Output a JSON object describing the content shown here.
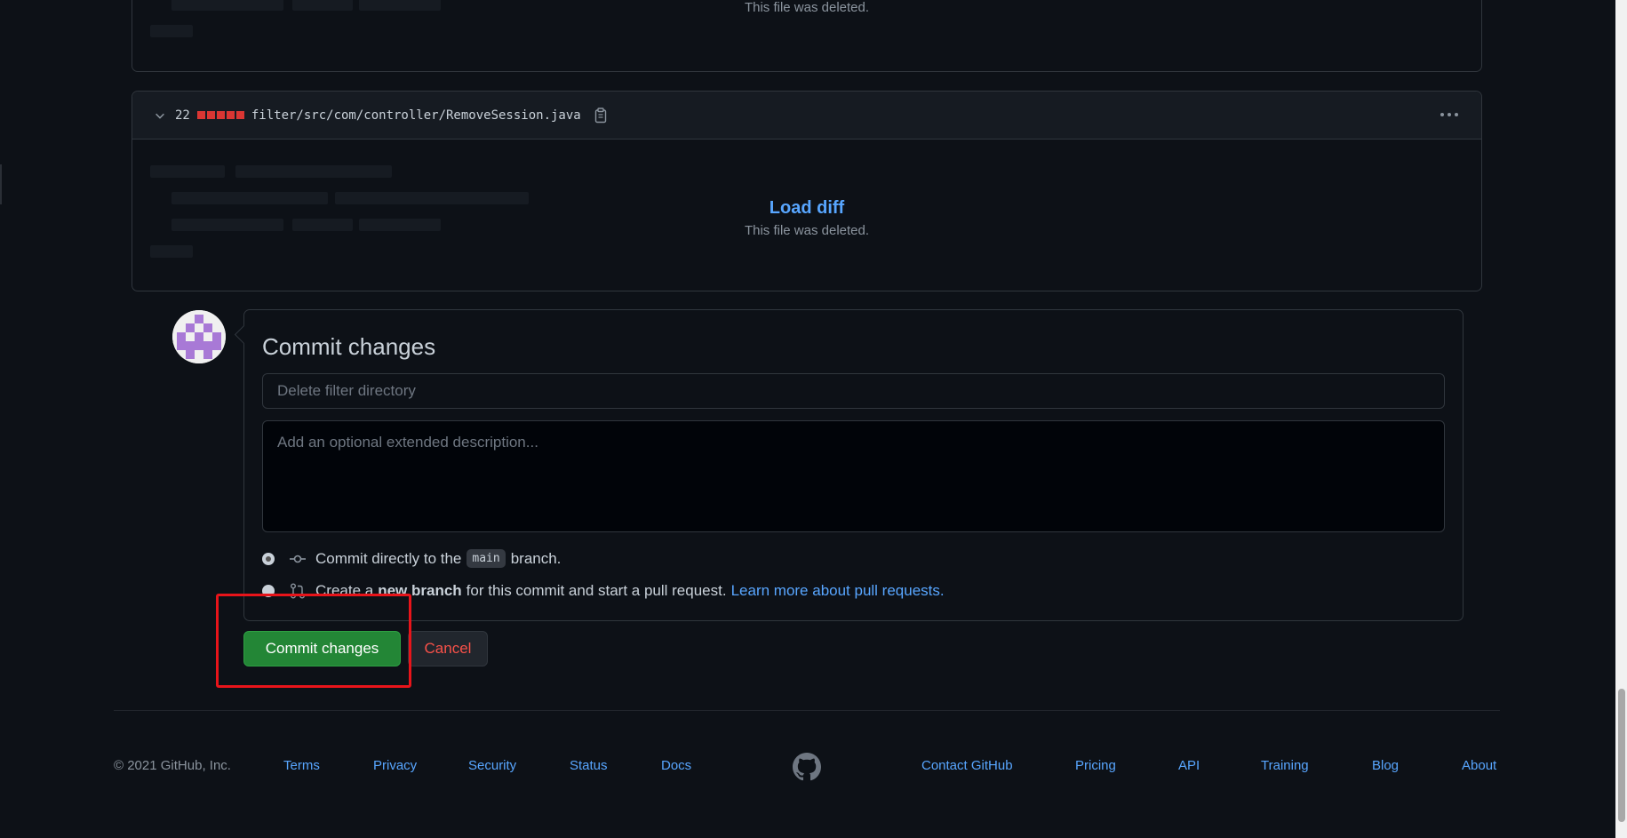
{
  "prev_file": {
    "deleted_text": "This file was deleted."
  },
  "file": {
    "change_count": "22",
    "path": "filter/src/com/controller/RemoveSession.java",
    "load_diff_label": "Load diff",
    "deleted_text": "This file was deleted.",
    "diffstat_color": "#da3633"
  },
  "commit": {
    "title": "Commit changes",
    "summary_placeholder": "Delete filter directory",
    "description_placeholder": "Add an optional extended description...",
    "option_direct": {
      "prefix": "Commit directly to the",
      "branch": "main",
      "suffix": "branch."
    },
    "option_new": {
      "prefix": "Create a",
      "bold": "new branch",
      "suffix": "for this commit and start a pull request.",
      "link": "Learn more about pull requests."
    },
    "commit_button": "Commit changes",
    "cancel_button": "Cancel"
  },
  "footer": {
    "copyright": "© 2021 GitHub, Inc.",
    "links_left": [
      "Terms",
      "Privacy",
      "Security",
      "Status",
      "Docs"
    ],
    "links_right": [
      "Contact GitHub",
      "Pricing",
      "API",
      "Training",
      "Blog",
      "About"
    ]
  },
  "colors": {
    "background": "#0d1117",
    "link": "#58a6ff",
    "primary_button": "#238636",
    "danger_text": "#f85149",
    "highlight": "#e8141a"
  }
}
